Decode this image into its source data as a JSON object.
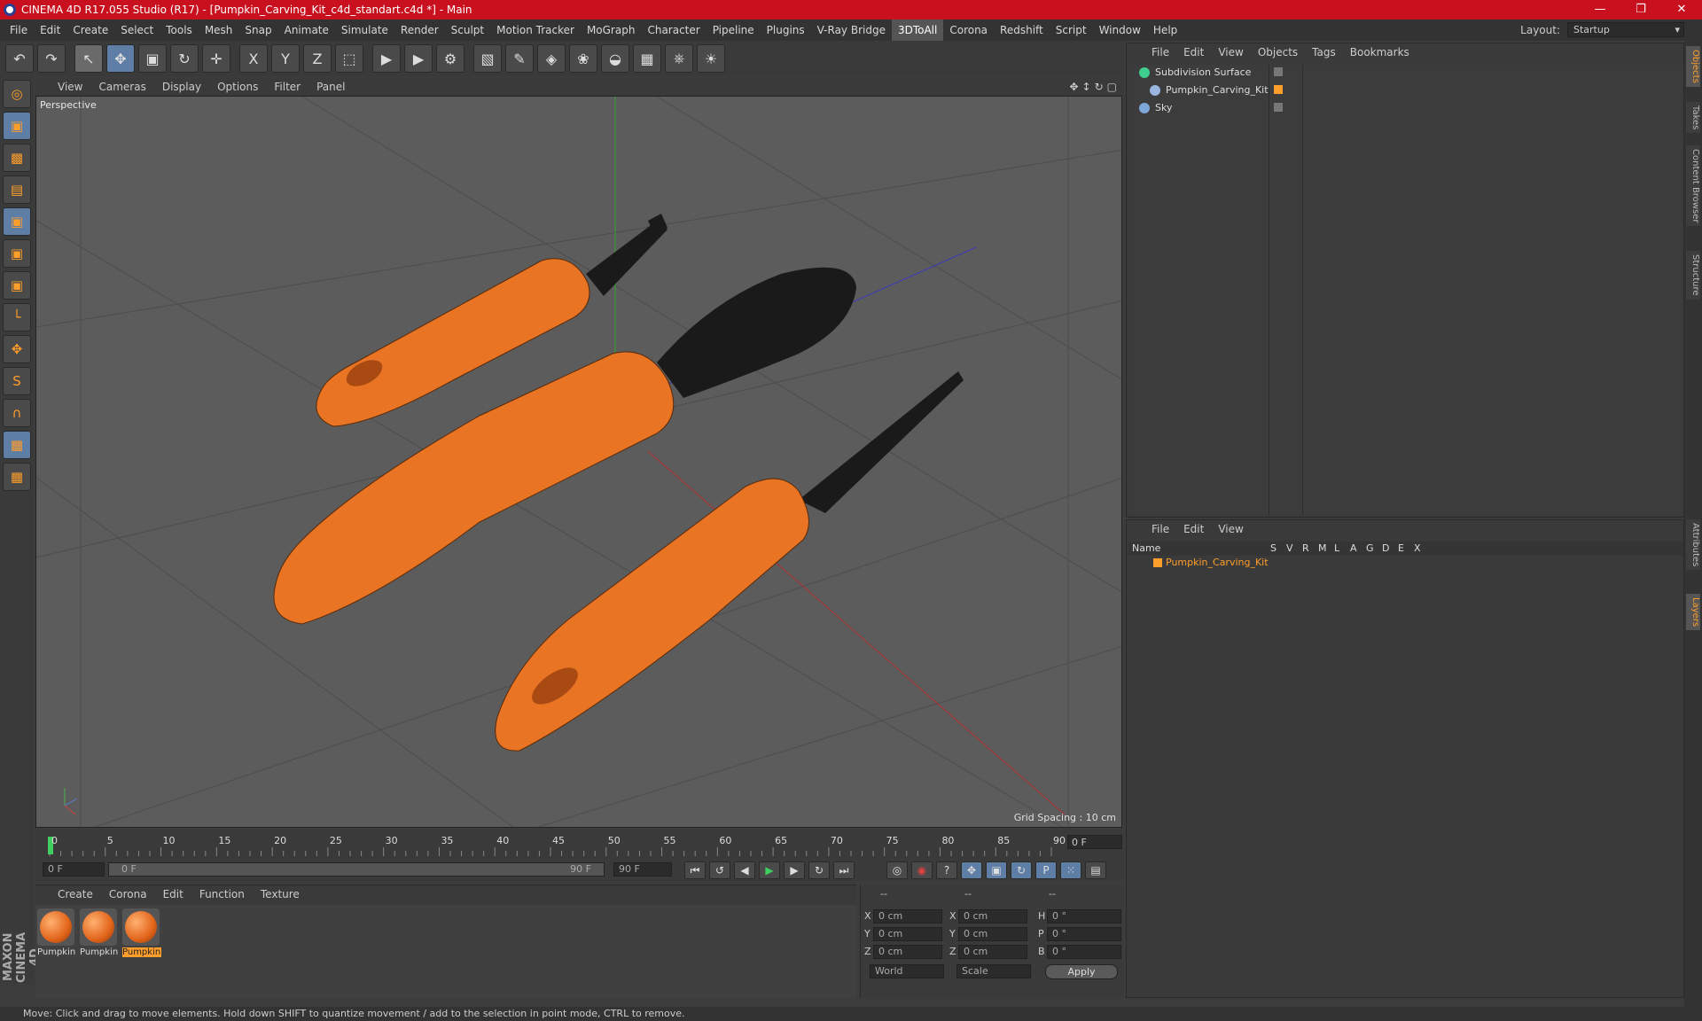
{
  "window": {
    "title": "CINEMA 4D R17.055 Studio (R17) - [Pumpkin_Carving_Kit_c4d_standart.c4d *] - Main",
    "minimize": "—",
    "restore": "❐",
    "close": "✕"
  },
  "menubar": {
    "items": [
      "File",
      "Edit",
      "Create",
      "Select",
      "Tools",
      "Mesh",
      "Snap",
      "Animate",
      "Simulate",
      "Render",
      "Sculpt",
      "Motion Tracker",
      "MoGraph",
      "Character",
      "Pipeline",
      "Plugins",
      "V-Ray Bridge",
      "3DToAll",
      "Corona",
      "Redshift",
      "Script",
      "Window",
      "Help"
    ],
    "highlighted": "3DToAll",
    "layout_label": "Layout:",
    "layout_value": "Startup"
  },
  "toolbar": {
    "icons": [
      "undo-icon",
      "redo-icon",
      "select-icon",
      "move-icon",
      "scale-icon",
      "rotate-icon",
      "transform-icon",
      "x-axis-icon",
      "y-axis-icon",
      "z-axis-icon",
      "coordinate-icon",
      "render-view-icon",
      "render-picture-icon",
      "render-settings-icon",
      "cube-icon",
      "pen-icon",
      "subdivision-icon",
      "cloner-icon",
      "deformer-icon",
      "floor-icon",
      "camera-icon",
      "light-icon"
    ],
    "glyphs": [
      "↶",
      "↷",
      "↖",
      "✥",
      "▣",
      "↻",
      "✛",
      "X",
      "Y",
      "Z",
      "⬚",
      "▶",
      "▶",
      "⚙",
      "▧",
      "✎",
      "◈",
      "❀",
      "◒",
      "▦",
      "⎈",
      "☀"
    ]
  },
  "left_tools": {
    "glyphs": [
      "◎",
      "▣",
      "▩",
      "▤",
      "▣",
      "▣",
      "▣",
      "└",
      "✥",
      "S",
      "∩",
      "▦",
      "▦"
    ]
  },
  "viewport": {
    "menu": [
      "View",
      "Cameras",
      "Display",
      "Options",
      "Filter",
      "Panel"
    ],
    "label": "Perspective",
    "grid_spacing": "Grid Spacing : 10 cm",
    "nav_icons": [
      "✥",
      "↕",
      "↻",
      "▢"
    ]
  },
  "timeline": {
    "ticks": [
      "0",
      "5",
      "10",
      "15",
      "20",
      "25",
      "30",
      "35",
      "40",
      "45",
      "50",
      "55",
      "60",
      "65",
      "70",
      "75",
      "80",
      "85",
      "90"
    ],
    "current_frame": "0 F",
    "start_field": "0 F",
    "range_start": "0 F",
    "range_end": "90 F",
    "end_field": "90 F"
  },
  "transport": {
    "buttons": [
      "⏮",
      "↺",
      "◀",
      "▶",
      "▶",
      "↻",
      "⏭"
    ],
    "right_buttons": [
      "◎",
      "◉",
      "?",
      "✥",
      "▣",
      "↻",
      "P",
      "⁙",
      "▤"
    ]
  },
  "materials": {
    "menu": [
      "Create",
      "Corona",
      "Edit",
      "Function",
      "Texture"
    ],
    "items": [
      {
        "name": "Pumpkin",
        "selected": false
      },
      {
        "name": "Pumpkin",
        "selected": false
      },
      {
        "name": "Pumpkin",
        "selected": true
      }
    ]
  },
  "coords": {
    "headers": [
      "--",
      "--",
      "--"
    ],
    "rows": [
      {
        "a": "X",
        "av": "0 cm",
        "b": "X",
        "bv": "0 cm",
        "c": "H",
        "cv": "0 °"
      },
      {
        "a": "Y",
        "av": "0 cm",
        "b": "Y",
        "bv": "0 cm",
        "c": "P",
        "cv": "0 °"
      },
      {
        "a": "Z",
        "av": "0 cm",
        "b": "Z",
        "bv": "0 cm",
        "c": "B",
        "cv": "0 °"
      }
    ],
    "mode": "World",
    "type": "Scale",
    "apply": "Apply"
  },
  "objects": {
    "menu": [
      "File",
      "Edit",
      "View",
      "Objects",
      "Tags",
      "Bookmarks"
    ],
    "items": [
      {
        "name": "Subdivision Surface",
        "icon_color": "#3ecf8e"
      },
      {
        "name": "Pumpkin_Carving_Kit",
        "icon_color": "#9ab6e0"
      },
      {
        "name": "Sky",
        "icon_color": "#7fa6d8"
      }
    ]
  },
  "layers": {
    "menu": [
      "File",
      "Edit",
      "View"
    ],
    "columns": [
      "Name",
      "S",
      "V",
      "R",
      "M",
      "L",
      "A",
      "G",
      "D",
      "E",
      "X"
    ],
    "row_name": "Pumpkin_Carving_Kit",
    "row_color": "#ff9e2a"
  },
  "right_tabs": [
    "Objects",
    "Takes",
    "Content Browser",
    "Structure",
    "Attributes",
    "Layers"
  ],
  "status": "Move: Click and drag to move elements. Hold down SHIFT to quantize movement / add to the selection in point mode, CTRL to remove.",
  "brand": "MAXON CINEMA 4D",
  "colors": {
    "accent": "#ff9e2a",
    "handle": "#e87424",
    "blade": "#1a1a1a",
    "titlebar": "#c8101e"
  }
}
